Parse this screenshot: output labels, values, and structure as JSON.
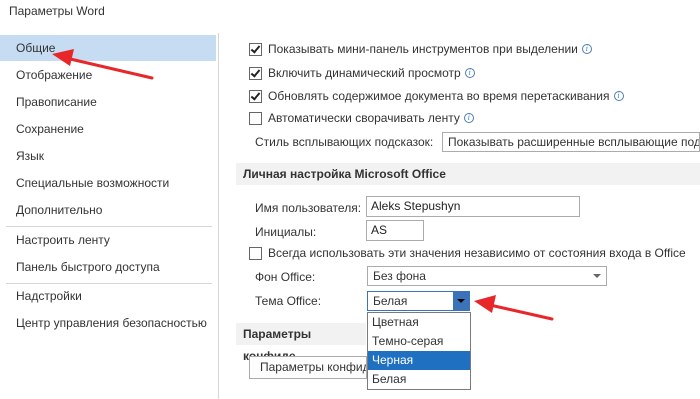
{
  "window": {
    "title": "Параметры Word"
  },
  "sidebar": {
    "items": [
      {
        "label": "Общие"
      },
      {
        "label": "Отображение"
      },
      {
        "label": "Правописание"
      },
      {
        "label": "Сохранение"
      },
      {
        "label": "Язык"
      },
      {
        "label": "Специальные возможности"
      },
      {
        "label": "Дополнительно"
      },
      {
        "label": "Настроить ленту"
      },
      {
        "label": "Панель быстрого доступа"
      },
      {
        "label": "Надстройки"
      },
      {
        "label": "Центр управления безопасностью"
      }
    ]
  },
  "ui_options": {
    "mini_toolbar": "Показывать мини-панель инструментов при выделении",
    "live_preview": "Включить динамический просмотр",
    "update_drag": "Обновлять содержимое документа во время перетаскивания",
    "collapse_ribbon": "Автоматически сворачивать ленту",
    "tooltip_style_label": "Стиль всплывающих подсказок:",
    "tooltip_style_value": "Показывать расширенные всплывающие под",
    "info_glyph": "i"
  },
  "personalize": {
    "header": "Личная настройка Microsoft Office",
    "username_label": "Имя пользователя:",
    "username_value": "Aleks Stepushyn",
    "initials_label": "Инициалы:",
    "initials_value": "AS",
    "always_use": "Всегда использовать эти значения независимо от состояния входа в Office",
    "background_label": "Фон Office:",
    "background_value": "Без фона",
    "theme_label": "Тема Office:",
    "theme_value": "Белая",
    "theme_options": [
      "Цветная",
      "Темно-серая",
      "Черная",
      "Белая"
    ]
  },
  "privacy": {
    "header": "Параметры конфиде",
    "button": "Параметры конфид"
  },
  "colors": {
    "active_nav": "#c6dcf2",
    "selected_option": "#1f70c1",
    "annotation_arrow": "#e8272a"
  }
}
